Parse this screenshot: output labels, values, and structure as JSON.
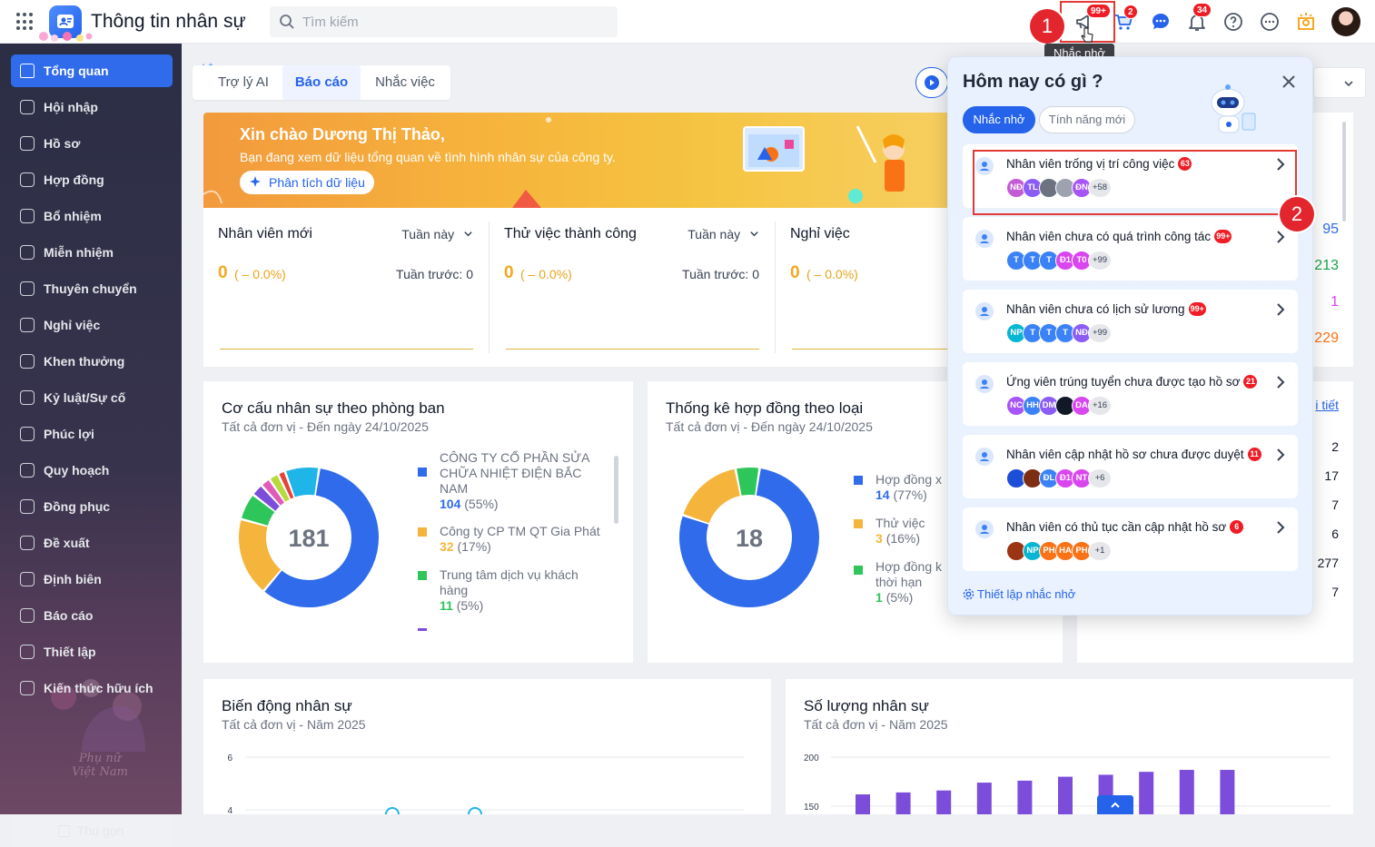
{
  "app": {
    "title": "Thông tin nhân sự"
  },
  "search": {
    "placeholder": "Tìm kiếm"
  },
  "header": {
    "reminder_badge": "99+",
    "cart_badge": "2",
    "notification_badge": "34",
    "tooltip": "Nhắc nhở",
    "step1": "1",
    "step2": "2"
  },
  "sidebar": {
    "items": [
      {
        "label": "Tổng quan",
        "icon": "home-icon"
      },
      {
        "label": "Hội nhập",
        "icon": "users-icon"
      },
      {
        "label": "Hồ sơ",
        "icon": "user-icon"
      },
      {
        "label": "Hợp đồng",
        "icon": "document-icon"
      },
      {
        "label": "Bổ nhiệm",
        "icon": "user-plus-icon"
      },
      {
        "label": "Miễn nhiệm",
        "icon": "user-minus-icon"
      },
      {
        "label": "Thuyên chuyển",
        "icon": "transfer-icon"
      },
      {
        "label": "Nghỉ việc",
        "icon": "user-x-icon"
      },
      {
        "label": "Khen thưởng",
        "icon": "award-icon"
      },
      {
        "label": "Kỷ luật/Sự cố",
        "icon": "shield-icon"
      },
      {
        "label": "Phúc lợi",
        "icon": "gift-icon"
      },
      {
        "label": "Quy hoạch",
        "icon": "plan-icon"
      },
      {
        "label": "Đồng phục",
        "icon": "shirt-icon"
      },
      {
        "label": "Đề xuất",
        "icon": "proposal-icon"
      },
      {
        "label": "Định biên",
        "icon": "headcount-icon"
      },
      {
        "label": "Báo cáo",
        "icon": "report-icon"
      },
      {
        "label": "Thiết lập",
        "icon": "gear-icon"
      },
      {
        "label": "Kiến thức hữu ích",
        "icon": "lightbulb-icon"
      }
    ],
    "collapse_label": "Thu gọn",
    "watermark_line1": "Phụ nữ",
    "watermark_line2": "Việt Nam"
  },
  "tabs": [
    {
      "label": "Trợ lý AI"
    },
    {
      "label": "Báo cáo"
    },
    {
      "label": "Nhắc việc"
    }
  ],
  "banner": {
    "greeting": "Xin chào Dương Thị Thảo,",
    "subtitle": "Bạn đang xem dữ liệu tổng quan về tình hình nhân sự của công ty.",
    "analyze_label": "Phân tích dữ liệu"
  },
  "stats": [
    {
      "label": "Nhân viên mới",
      "period": "Tuần này",
      "value": "0",
      "change": "( – 0.0%)",
      "previous": "Tuần trước: 0"
    },
    {
      "label": "Thử việc thành công",
      "period": "Tuần này",
      "value": "0",
      "change": "( – 0.0%)",
      "previous": "Tuần trước: 0"
    },
    {
      "label": "Nghỉ việc",
      "period": "",
      "value": "0",
      "change": "( – 0.0%)",
      "previous": ""
    }
  ],
  "right_card": {
    "numbers": [
      "95",
      "213",
      "1",
      "229"
    ],
    "link": "i tiết",
    "table_values": [
      "2",
      "17",
      "7",
      "6",
      "277",
      "7"
    ]
  },
  "department_chart": {
    "title": "Cơ cấu nhân sự theo phòng ban",
    "subtitle": "Tất cả đơn vị - Đến ngày 24/10/2025",
    "total": "181",
    "legend": [
      {
        "name": "CÔNG TY CỔ PHẦN SỬA CHỮA NHIỆT ĐIỆN BẮC NAM",
        "value": "104",
        "pct": "(55%)",
        "color": "#2f6bea"
      },
      {
        "name": "Công ty CP TM QT Gia Phát",
        "value": "32",
        "pct": "(17%)",
        "color": "#f5b53c"
      },
      {
        "name": "Trung tâm dịch vụ khách hàng",
        "value": "11",
        "pct": "(5%)",
        "color": "#2ec55a"
      }
    ]
  },
  "contract_chart": {
    "title": "Thống kê hợp đồng theo loại",
    "subtitle": "Tất cả đơn vị - Đến ngày 24/10/2025",
    "total": "18",
    "legend": [
      {
        "name": "Hợp đồng x",
        "value": "14",
        "pct": "(77%)",
        "color": "#2f6bea"
      },
      {
        "name": "Thử việc",
        "value": "3",
        "pct": "(16%)",
        "color": "#f5b53c"
      },
      {
        "name": "Hợp đồng k thời hạn",
        "value": "1",
        "pct": "(5%)",
        "color": "#2ec55a"
      }
    ]
  },
  "chart_data": [
    {
      "type": "pie",
      "title": "Cơ cấu nhân sự theo phòng ban",
      "subtitle": "Tất cả đơn vị - Đến ngày 24/10/2025",
      "center_label": "181",
      "slices": [
        {
          "name": "CÔNG TY CỔ PHẦN SỬA CHỮA NHIỆT ĐIỆN BẮC NAM",
          "value": 104,
          "color": "#2f6bea"
        },
        {
          "name": "Công ty CP TM QT Gia Phát",
          "value": 32,
          "color": "#f5b53c"
        },
        {
          "name": "Trung tâm dịch vụ khách hàng",
          "value": 11,
          "color": "#2ec55a"
        },
        {
          "name": "",
          "value": 5,
          "color": "#7c4ddb"
        },
        {
          "name": "",
          "value": 4,
          "color": "#e05cb8"
        },
        {
          "name": "",
          "value": 4,
          "color": "#b6d93b"
        },
        {
          "name": "",
          "value": 3,
          "color": "#e8413b"
        },
        {
          "name": "",
          "value": 14,
          "color": "#1fb5e8"
        }
      ]
    },
    {
      "type": "pie",
      "title": "Thống kê hợp đồng theo loại",
      "subtitle": "Tất cả đơn vị - Đến ngày 24/10/2025",
      "center_label": "18",
      "slices": [
        {
          "name": "Hợp đồng x",
          "value": 14,
          "color": "#2f6bea"
        },
        {
          "name": "Thử việc",
          "value": 3,
          "color": "#f5b53c"
        },
        {
          "name": "Hợp đồng k thời hạn",
          "value": 1,
          "color": "#2ec55a"
        }
      ]
    },
    {
      "type": "line",
      "title": "Biến động nhân sự",
      "subtitle": "Tất cả đơn vị - Năm 2025",
      "y_ticks": [
        "6",
        "4"
      ],
      "ylim": [
        0,
        6
      ]
    },
    {
      "type": "bar",
      "title": "Số lượng nhân sự",
      "subtitle": "Tất cả đơn vị - Năm 2025",
      "y_ticks": [
        "200",
        "150"
      ],
      "values": [
        162,
        164,
        166,
        174,
        176,
        180,
        182,
        185,
        187,
        187
      ],
      "color": "#7c4ddb",
      "ylim": [
        0,
        200
      ]
    }
  ],
  "panel": {
    "title": "Hôm nay có gì ?",
    "tabs": [
      {
        "label": "Nhắc nhở"
      },
      {
        "label": "Tính năng mới"
      }
    ],
    "items": [
      {
        "title": "Nhân viên trống vị trí công việc",
        "badge": "63",
        "icon": "user-icon",
        "avatars": [
          {
            "t": "NĐ",
            "c": "#c45bd6"
          },
          {
            "t": "TL",
            "c": "#8b5cf6"
          },
          {
            "t": "",
            "c": "#6b7280"
          },
          {
            "t": "",
            "c": "#9ca3af"
          },
          {
            "t": "ĐN",
            "c": "#a855f7"
          }
        ],
        "more": "+58"
      },
      {
        "title": "Nhân viên chưa có quá trình công tác",
        "badge": "99+",
        "icon": "briefcase-icon",
        "avatars": [
          {
            "t": "T",
            "c": "#3b82f6"
          },
          {
            "t": "T",
            "c": "#3b82f6"
          },
          {
            "t": "T",
            "c": "#3b82f6"
          },
          {
            "t": "Đ1",
            "c": "#d946ef"
          },
          {
            "t": "T0",
            "c": "#d946ef"
          }
        ],
        "more": "+99"
      },
      {
        "title": "Nhân viên chưa có lịch sử lương",
        "badge": "99+",
        "icon": "coins-icon",
        "avatars": [
          {
            "t": "NP",
            "c": "#06b6d4"
          },
          {
            "t": "T",
            "c": "#3b82f6"
          },
          {
            "t": "T",
            "c": "#3b82f6"
          },
          {
            "t": "T",
            "c": "#3b82f6"
          },
          {
            "t": "NĐ",
            "c": "#8b5cf6"
          }
        ],
        "more": "+99"
      },
      {
        "title": "Ứng viên trúng tuyển chưa được tạo hồ sơ",
        "badge": "21",
        "icon": "user-add-icon",
        "avatars": [
          {
            "t": "NC",
            "c": "#a855f7"
          },
          {
            "t": "HH",
            "c": "#3b82f6"
          },
          {
            "t": "DM",
            "c": "#8b5cf6"
          },
          {
            "t": "",
            "c": "#111827"
          },
          {
            "t": "DA",
            "c": "#d946ef"
          }
        ],
        "more": "+16"
      },
      {
        "title": "Nhân viên cập nhật hồ sơ chưa được duyệt",
        "badge": "11",
        "icon": "check-icon",
        "avatars": [
          {
            "t": "",
            "c": "#1d4ed8"
          },
          {
            "t": "",
            "c": "#7c2d12"
          },
          {
            "t": "ĐL",
            "c": "#3b82f6"
          },
          {
            "t": "Đ1",
            "c": "#d946ef"
          },
          {
            "t": "NT",
            "c": "#d946ef"
          }
        ],
        "more": "+6"
      },
      {
        "title": "Nhân viên có thủ tục cần cập nhật hồ sơ",
        "badge": "6",
        "icon": "edit-icon",
        "avatars": [
          {
            "t": "",
            "c": "#9a3412"
          },
          {
            "t": "NP",
            "c": "#06b6d4"
          },
          {
            "t": "PH",
            "c": "#f97316"
          },
          {
            "t": "HA",
            "c": "#f97316"
          },
          {
            "t": "PH",
            "c": "#f97316"
          }
        ],
        "more": "+1"
      }
    ],
    "setup_label": "Thiết lập nhắc nhở"
  },
  "bottom": {
    "left_title": "Biến động nhân sự",
    "left_sub": "Tất cả đơn vị - Năm 2025",
    "right_title": "Số lượng nhân sự",
    "right_sub": "Tất cả đơn vị - Năm 2025"
  },
  "colors": {
    "accent": "#2563eb",
    "danger": "#ef1c25",
    "sidebar": "#2b2e45"
  }
}
